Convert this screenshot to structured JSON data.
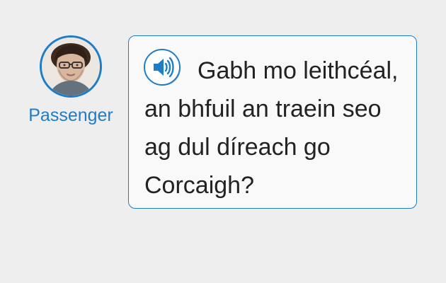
{
  "speaker": {
    "name": "Passenger"
  },
  "message": {
    "text": "Gabh mo leithcéal, an bhfuil an traein seo ag dul díreach go Corcaigh?"
  },
  "icons": {
    "audio": "speaker-volume-icon"
  },
  "colors": {
    "accent": "#1f7dc8",
    "background": "#eeeeee",
    "bubble": "#f9f9f9",
    "text": "#222222"
  }
}
